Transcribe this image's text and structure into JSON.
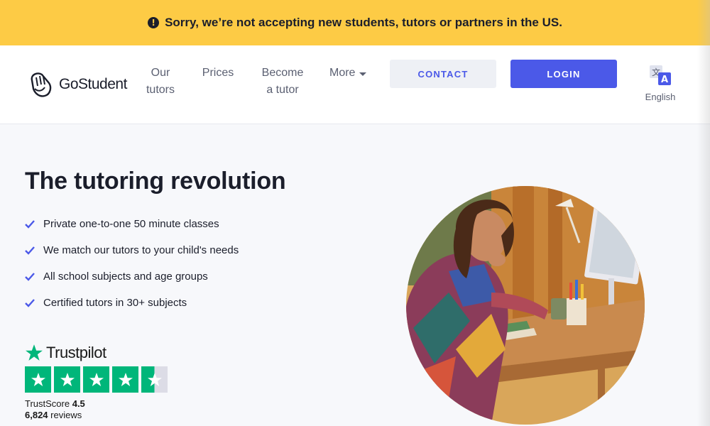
{
  "banner": {
    "icon": "exclamation-circle-icon",
    "text": "Sorry, we’re not accepting new students, tutors or partners in the US."
  },
  "brand": {
    "name": "GoStudent",
    "logo_icon": "gostudent-logo-icon"
  },
  "nav": {
    "our_tutors_line1": "Our",
    "our_tutors_line2": "tutors",
    "prices": "Prices",
    "become_line1": "Become",
    "become_line2": "a tutor",
    "more": "More"
  },
  "buttons": {
    "contact": "CONTACT",
    "login": "LOGIN"
  },
  "language": {
    "label": "English",
    "icon": "translate-icon"
  },
  "hero": {
    "title": "The tutoring revolution",
    "features": [
      "Private one-to-one 50 minute classes",
      "We match our tutors to your child's needs",
      "All school subjects and age groups",
      "Certified tutors in 30+ subjects"
    ]
  },
  "trustpilot": {
    "brand": "Trustpilot",
    "score_label": "TrustScore",
    "score": "4.5",
    "reviews_count": "6,824",
    "reviews_label": "reviews",
    "rating": 4.5,
    "max_rating": 5
  },
  "colors": {
    "banner": "#fdcb45",
    "accent": "#4b59e8",
    "trustpilot_green": "#00b67a",
    "text": "#1b1e2b"
  }
}
